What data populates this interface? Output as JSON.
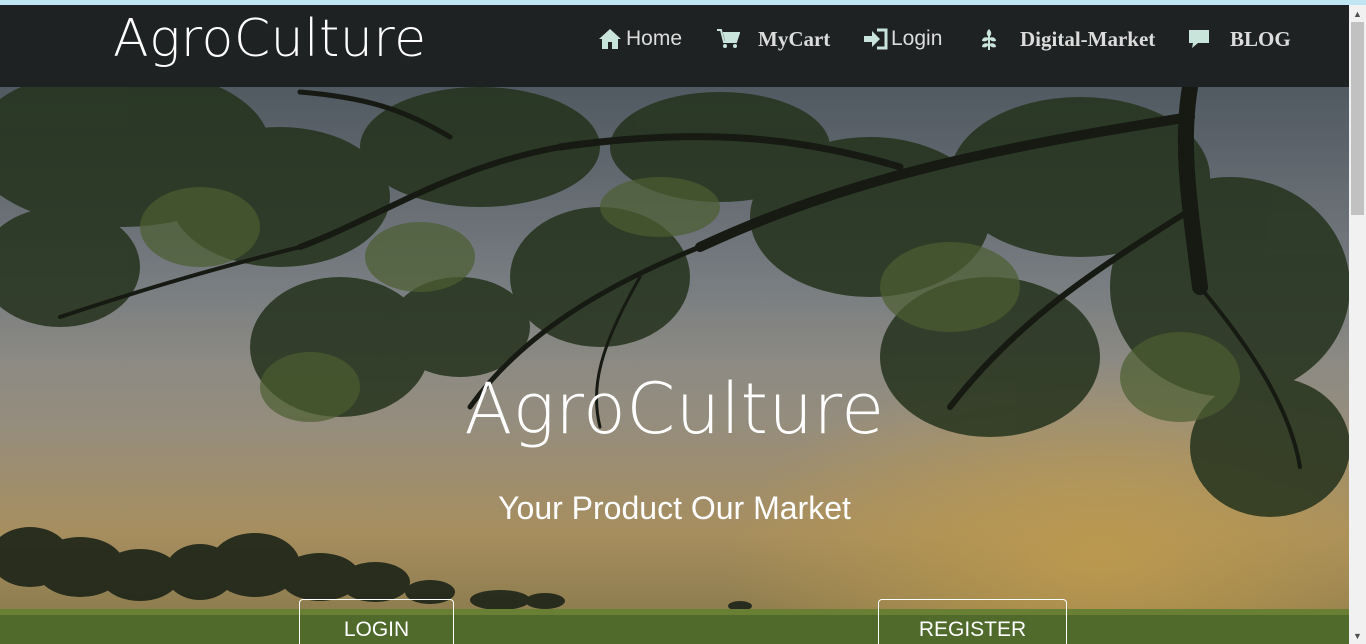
{
  "navbar": {
    "brand": "AgroCulture",
    "items": [
      {
        "label": "Home",
        "icon": "home-icon"
      },
      {
        "label": "MyCart",
        "icon": "cart-icon"
      },
      {
        "label": "Login",
        "icon": "login-icon"
      },
      {
        "label": "Digital-Market",
        "icon": "leaf-icon"
      },
      {
        "label": "BLOG",
        "icon": "comment-icon"
      }
    ],
    "background": "#1f2222"
  },
  "hero": {
    "title": "AgroCulture",
    "subtitle": "Your Product Our Market",
    "login_button": "LOGIN",
    "register_button": "REGISTER"
  }
}
